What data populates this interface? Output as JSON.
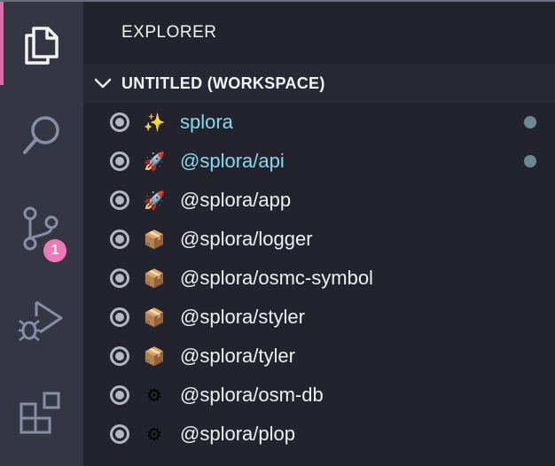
{
  "activity_bar": {
    "items": [
      {
        "name": "explorer-icon"
      },
      {
        "name": "search-icon"
      },
      {
        "name": "source-control-icon",
        "badge": "1"
      },
      {
        "name": "run-debug-icon"
      },
      {
        "name": "extensions-icon"
      }
    ],
    "accent_color": "#e06aa6",
    "badge_color": "#ef79b6"
  },
  "sidebar": {
    "title": "EXPLORER",
    "section": {
      "label": "UNTITLED (WORKSPACE)",
      "expanded": true,
      "folders": [
        {
          "icon": "✨",
          "icon_name": "sparkles-icon",
          "label": "splora",
          "modified": true
        },
        {
          "icon": "🚀",
          "icon_name": "rocket-icon",
          "label": "@splora/api",
          "modified": true
        },
        {
          "icon": "🚀",
          "icon_name": "rocket-icon",
          "label": "@splora/app",
          "modified": false
        },
        {
          "icon": "📦",
          "icon_name": "package-icon",
          "label": "@splora/logger",
          "modified": false
        },
        {
          "icon": "📦",
          "icon_name": "package-icon",
          "label": "@splora/osmc-symbol",
          "modified": false
        },
        {
          "icon": "📦",
          "icon_name": "package-icon",
          "label": "@splora/styler",
          "modified": false
        },
        {
          "icon": "📦",
          "icon_name": "package-icon",
          "label": "@splora/tyler",
          "modified": false
        },
        {
          "icon": "⚙",
          "icon_name": "gear-icon",
          "label": "@splora/osm-db",
          "modified": false
        },
        {
          "icon": "⚙",
          "icon_name": "gear-icon",
          "label": "@splora/plop",
          "modified": false
        }
      ]
    }
  }
}
